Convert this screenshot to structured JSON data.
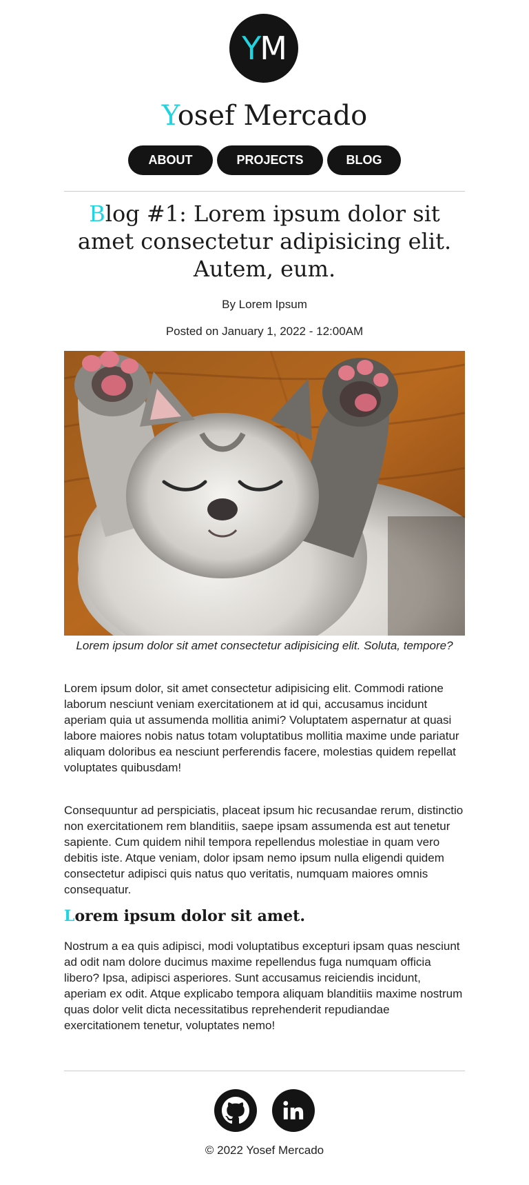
{
  "header": {
    "logo_initial_1": "Y",
    "logo_initial_2": "M",
    "site_title_first_letter": "Y",
    "site_title_rest": "osef Mercado"
  },
  "nav": {
    "items": [
      {
        "label": "ABOUT"
      },
      {
        "label": "PROJECTS"
      },
      {
        "label": "BLOG"
      }
    ]
  },
  "post": {
    "title_first_letter": "B",
    "title_rest": "log #1: Lorem ipsum dolor sit amet consectetur adipisicing elit. Autem, eum.",
    "byline": "By Lorem Ipsum",
    "posted": "Posted on January 1, 2022 - 12:00AM",
    "image_subject": "sleeping-kitten-photo",
    "caption": "Lorem ipsum dolor sit amet consectetur adipisicing elit. Soluta, tempore?",
    "paragraphs": [
      "Lorem ipsum dolor, sit amet consectetur adipisicing elit. Commodi ratione laborum nesciunt veniam exercitationem at id qui, accusamus incidunt aperiam quia ut assumenda mollitia animi? Voluptatem aspernatur at quasi labore maiores nobis natus totam voluptatibus mollitia maxime unde pariatur aliquam doloribus ea nesciunt perferendis facere, molestias quidem repellat voluptates quibusdam!",
      "Consequuntur ad perspiciatis, placeat ipsum hic recusandae rerum, distinctio non exercitationem rem blanditiis, saepe ipsam assumenda est aut tenetur sapiente. Cum quidem nihil tempora repellendus molestiae in quam vero debitis iste. Atque veniam, dolor ipsam nemo ipsum nulla eligendi quidem consectetur adipisci quis natus quo veritatis, numquam maiores omnis consequatur."
    ],
    "subheading_first_letter": "L",
    "subheading_rest": "orem ipsum dolor sit amet.",
    "paragraph_3": "Nostrum a ea quis adipisci, modi voluptatibus excepturi ipsam quas nesciunt ad odit nam dolore ducimus maxime repellendus fuga numquam officia libero? Ipsa, adipisci asperiores. Sunt accusamus reiciendis incidunt, aperiam ex odit. Atque explicabo tempora aliquam blanditiis maxime nostrum quas dolor velit dicta necessitatibus reprehenderit repudiandae exercitationem tenetur, voluptates nemo!"
  },
  "footer": {
    "social": [
      {
        "icon": "github-icon"
      },
      {
        "icon": "linkedin-icon"
      }
    ],
    "copyright": "© 2022 Yosef Mercado"
  },
  "colors": {
    "accent": "#22d3e0",
    "dark": "#141414",
    "text": "#222222",
    "divider": "#cccccc"
  }
}
